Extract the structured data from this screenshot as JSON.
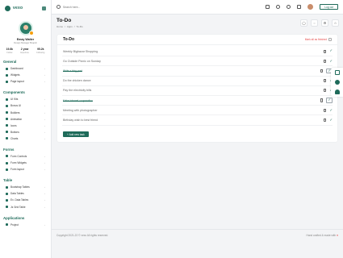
{
  "brand": {
    "name": "vexo"
  },
  "profile": {
    "name": "Emay Walter",
    "role": "Design Manager Bnapoli",
    "stats": [
      {
        "value": "19.8k",
        "label": "Follow"
      },
      {
        "value": "2 year",
        "label": "Experince"
      },
      {
        "value": "95.2k",
        "label": "Following"
      }
    ]
  },
  "sidebar": {
    "sections": [
      {
        "title": "General",
        "items": [
          "Dashboard",
          "Widgets",
          "Page layout"
        ]
      },
      {
        "title": "Components",
        "items": [
          "UI Kits",
          "Bonus UI",
          "Builders",
          "Animation",
          "Icons",
          "Buttons",
          "Charts"
        ]
      },
      {
        "title": "Forms",
        "items": [
          "Form Controls",
          "Form Widgets",
          "Form layout"
        ]
      },
      {
        "title": "Table",
        "items": [
          "Bootstrap Tables",
          "Data Tables",
          "Ex. Data Tables",
          "Js Grid Table"
        ]
      },
      {
        "title": "Applications",
        "items": [
          "Project"
        ]
      }
    ]
  },
  "topbar": {
    "search_placeholder": "Search here...",
    "logout_label": "Log out",
    "icons": [
      "maximize-icon",
      "moon-icon",
      "bell-icon",
      "message-icon"
    ]
  },
  "page": {
    "title": "To-Do",
    "breadcrumb": [
      "Home",
      "/",
      "Apps",
      "/",
      "To-Do"
    ],
    "header_icons": [
      "chat-icon",
      "bookmark-icon",
      "settings-icon",
      "star-icon"
    ]
  },
  "card": {
    "title": "To-Do",
    "mark_all_label": "Mark all as finished",
    "add_label": "+ Add new task",
    "items": [
      {
        "text": "Weekly Bigbazar Shopping",
        "done": false
      },
      {
        "text": "Go Outside Picnic on Sunday",
        "done": false
      },
      {
        "text": "Write a blog post",
        "done": true
      },
      {
        "text": "Do the chicken dance",
        "done": false
      },
      {
        "text": "Pay the electricity bills",
        "done": false
      },
      {
        "text": "Make internet cooperation",
        "done": true
      },
      {
        "text": "Meeting with photographer",
        "done": false
      },
      {
        "text": "Birthday wish to best friend",
        "done": false
      }
    ]
  },
  "float_strip": {
    "icons": [
      "layout-icon",
      "palette-icon",
      "cloud-icon"
    ],
    "colors": [
      "#1f6b5a",
      "#1f6b5a",
      "#1f6b5a"
    ]
  },
  "footer": {
    "copyright": "Copyright 2021-22 © vexo All rights reserved.",
    "made_with": "Hand crafted & made with"
  },
  "colors": {
    "accent": "#1f6b5a",
    "danger": "#e64d4d"
  }
}
